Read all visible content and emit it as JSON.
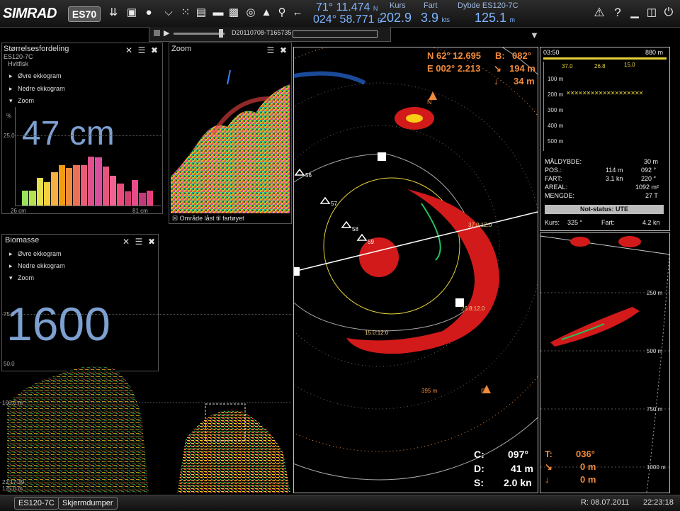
{
  "app": {
    "logo": "SIMRAD",
    "model": "ES70"
  },
  "nav": {
    "lat": "71° 11.474",
    "lat_hem": "N",
    "lon": "024° 58.771",
    "lon_hem": "E",
    "kurs_label": "Kurs",
    "kurs_value": "202.9",
    "fart_label": "Fart",
    "fart_value": "3.9",
    "fart_unit": "kts",
    "dybde_label": "Dybde ES120-7C",
    "dybde_value": "125.1",
    "dybde_unit": "m"
  },
  "replay": {
    "file": "D20110708-T165735"
  },
  "size_panel": {
    "title": "Størrelsesfordeling",
    "sub1": "ES120-7C",
    "sub2": "Hvitfisk",
    "items": [
      "Øvre ekkogram",
      "Nedre ekkogram",
      "Zoom"
    ],
    "value": "47 cm",
    "pct": "%",
    "ytick": "25.0",
    "xmin": "26 cm",
    "xmax": "81 cm",
    "bars": [
      0.28,
      0.28,
      0.5,
      0.42,
      0.6,
      0.72,
      0.68,
      0.72,
      0.72,
      0.88,
      0.86,
      0.7,
      0.54,
      0.4,
      0.26,
      0.46,
      0.24,
      0.28
    ]
  },
  "zoom_panel": {
    "title": "Zoom",
    "locked": "Område låst til fartøyet"
  },
  "biomass_panel": {
    "title": "Biomasse",
    "items": [
      "Øvre ekkogram",
      "Nedre ekkogram",
      "Zoom"
    ],
    "value": "1600",
    "ytick1": "75.0",
    "ytick2": "50.0"
  },
  "echogram": {
    "depth1": "100.0 m",
    "time": "22:17:39",
    "depth2": "125.0 m"
  },
  "sonar": {
    "pos_n": "N 62° 12.695",
    "pos_e": "E 002° 2.213",
    "b_label": "B:",
    "b_value": "082°",
    "range_value": "194 m",
    "depth_value": "34 m",
    "compass_n": "N",
    "compass_e": "E",
    "markers": [
      "56",
      "57",
      "58",
      "59"
    ],
    "labels": [
      "37.0:12.0",
      "26.8:12.0",
      "15.0:12.0"
    ],
    "ring": "395 m",
    "c_label": "C:",
    "c_value": "097°",
    "d_label": "D:",
    "d_value": "41 m",
    "s_label": "S:",
    "s_value": "2.0 kn"
  },
  "info": {
    "time": "03:50",
    "range": "880 m",
    "scale": [
      "37.0",
      "26.8",
      "15.0"
    ],
    "depths": [
      "100 m",
      "200 m",
      "300 m",
      "400 m",
      "500 m"
    ],
    "rows": [
      [
        "MÅLDYBDE:",
        "",
        "30 m"
      ],
      [
        "POS.:",
        "114 m",
        "092 °"
      ],
      [
        "FART:",
        "3.1 kn",
        "220 °"
      ],
      [
        "AREAL:",
        "",
        "1092 m²"
      ],
      [
        "MENGDE:",
        "",
        "27 T"
      ]
    ],
    "status": "Not-status: UTE",
    "kurs_label": "Kurs:",
    "kurs_value": "325 °",
    "fart_label": "Fart:",
    "fart_value": "4.2 kn"
  },
  "vert": {
    "depths": [
      "250 m",
      "500 m",
      "750 m",
      "1000 m"
    ],
    "t_label": "T:",
    "t_value": "036°",
    "r_value": "0 m",
    "d_value": "0 m"
  },
  "status": {
    "btn1": "ES120-7C",
    "btn2": "Skjermdumper",
    "replay_date": "R: 08.07.2011",
    "clock": "22:23:18"
  }
}
